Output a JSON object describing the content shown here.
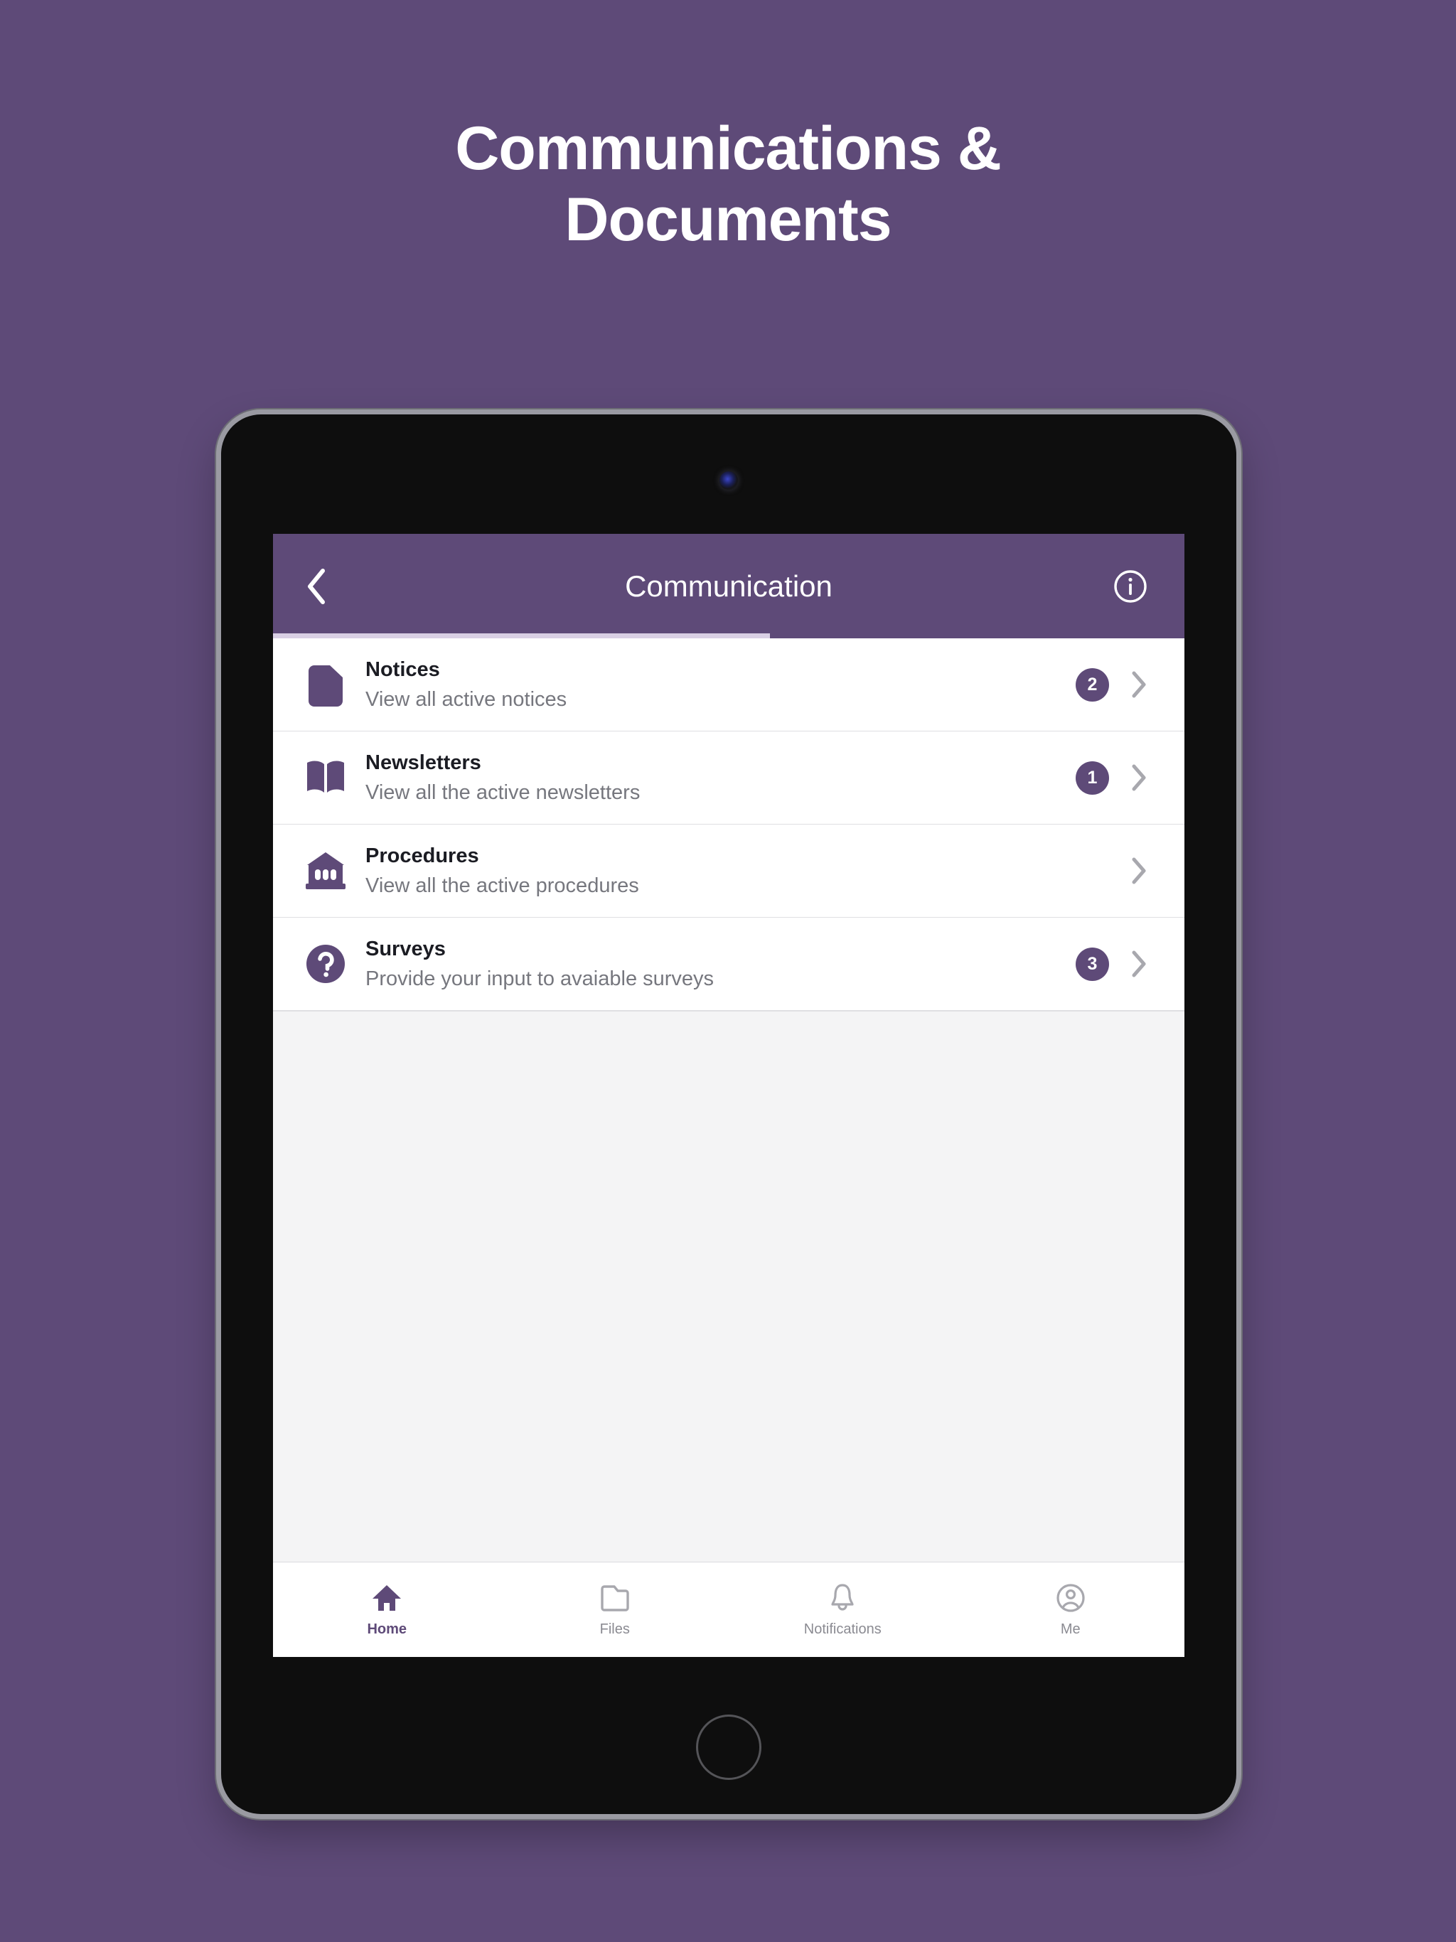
{
  "page": {
    "heading_line1": "Communications &",
    "heading_line2": "Documents",
    "background_color": "#5E4A78",
    "accent_color": "#5E4A78"
  },
  "app": {
    "header": {
      "back_label": "Back",
      "title": "Communication",
      "info_label": "Info"
    },
    "list": [
      {
        "icon": "document-icon",
        "title": "Notices",
        "subtitle": "View all active notices",
        "badge": "2"
      },
      {
        "icon": "open-book-icon",
        "title": "Newsletters",
        "subtitle": "View all the active newsletters",
        "badge": "1"
      },
      {
        "icon": "bank-building-icon",
        "title": "Procedures",
        "subtitle": "View all the active procedures",
        "badge": ""
      },
      {
        "icon": "question-mark-circle-icon",
        "title": "Surveys",
        "subtitle": "Provide your input to avaiable surveys",
        "badge": "3"
      }
    ],
    "bottom_nav": [
      {
        "icon": "home-icon",
        "label": "Home",
        "active": true
      },
      {
        "icon": "folder-icon",
        "label": "Files",
        "active": false
      },
      {
        "icon": "bell-icon",
        "label": "Notifications",
        "active": false
      },
      {
        "icon": "person-circle-icon",
        "label": "Me",
        "active": false
      }
    ]
  }
}
